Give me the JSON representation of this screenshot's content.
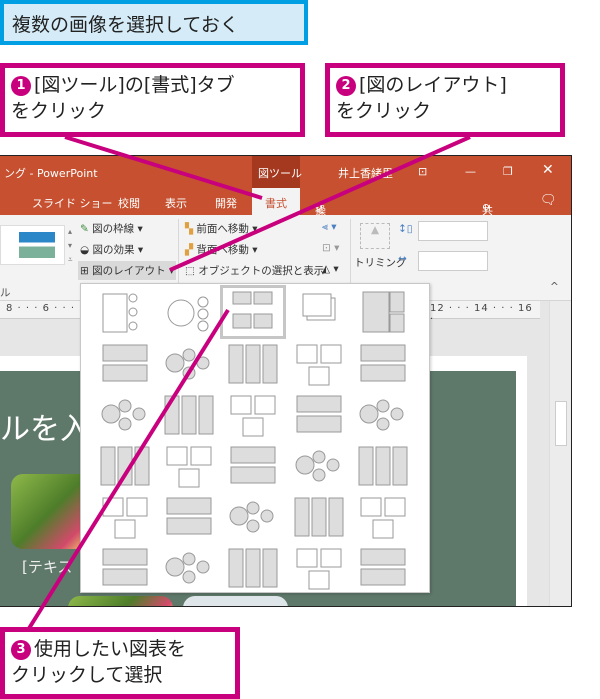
{
  "title_box": "複数の画像を選択しておく",
  "callouts": [
    {
      "num": "1",
      "line1": "[図ツール]の[書式]タブ",
      "line2": "をクリック"
    },
    {
      "num": "2",
      "line1": "[図のレイアウト]",
      "line2": "をクリック"
    },
    {
      "num": "3",
      "line1": "使用したい図表を",
      "line2": "クリックして選択"
    }
  ],
  "window": {
    "title": "ング - PowerPoint",
    "context_tab": "図ツール",
    "user": "井上香緒里",
    "tabs": [
      "スライド ショー",
      "校閲",
      "表示",
      "開発"
    ],
    "active_tab": "書式",
    "tell_me": "操作アシスト",
    "share": "共有"
  },
  "ribbon": {
    "picture_border": "図の枠線",
    "picture_effects": "図の効果",
    "picture_layout": "図のレイアウト",
    "bring_forward": "前面へ移動",
    "send_backward": "背面へ移動",
    "selection_pane": "オブジェクトの選択と表示",
    "crop": "トリミング",
    "group_label_left": "ル"
  },
  "ruler": {
    "left": "8 · · · 6 · · ·",
    "right": "12 · · · 14 · · · 16 ·"
  },
  "slide": {
    "title": "ルを入",
    "text": "[テキス"
  },
  "colors": {
    "accent": "#c8007d",
    "title_border": "#009fe3",
    "office": "#c6502f",
    "slide": "#5e786a"
  }
}
